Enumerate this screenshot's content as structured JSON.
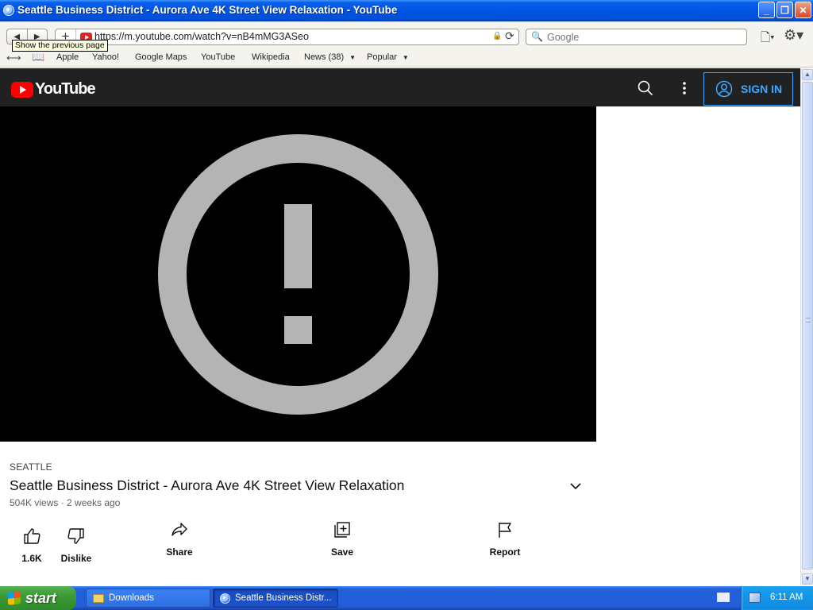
{
  "window": {
    "title": "Seattle Business District - Aurora Ave 4K Street View Relaxation - YouTube",
    "controls": {
      "minimize": "_",
      "maximize": "❐",
      "close": "✕"
    }
  },
  "toolbar": {
    "back_glyph": "◀",
    "forward_glyph": "▶",
    "new_tab_glyph": "+",
    "url": "https://m.youtube.com/watch?v=nB4mMG3ASeo",
    "lock_glyph": "🔒",
    "reload_glyph": "⟳",
    "search_placeholder": "Google",
    "search_glyph": "🔍",
    "page_menu_glyph": "🗋▾",
    "settings_glyph": "⚙▾"
  },
  "bookmarks": {
    "reading_glyph": "⟷",
    "book_glyph": "📖",
    "items": [
      {
        "label": "Apple"
      },
      {
        "label": "Yahoo!"
      },
      {
        "label": "Google Maps"
      },
      {
        "label": "YouTube"
      },
      {
        "label": "Wikipedia"
      },
      {
        "label": "News (38)",
        "arrow": "▼"
      },
      {
        "label": "Popular",
        "arrow": "▼"
      }
    ],
    "tooltip": "Show the previous page"
  },
  "youtube": {
    "logo_text": "YouTube",
    "sign_in_label": "SIGN IN",
    "video": {
      "hashtag": "SEATTLE",
      "title": "Seattle Business District - Aurora Ave 4K Street View Relaxation",
      "stats": "504K views · 2 weeks ago"
    },
    "actions": {
      "like": "1.6K",
      "dislike": "Dislike",
      "share": "Share",
      "save": "Save",
      "report": "Report"
    },
    "colors": {
      "header_bg": "#212121",
      "accent_blue": "#3ea6ff",
      "logo_red": "#ff0000"
    }
  },
  "scrollbar": {
    "up_glyph": "▲",
    "down_glyph": "▼"
  },
  "taskbar": {
    "start_label": "start",
    "tasks": [
      {
        "label": "Downloads"
      },
      {
        "label": "Seattle Business Distr..."
      }
    ],
    "clock": "6:11 AM"
  }
}
